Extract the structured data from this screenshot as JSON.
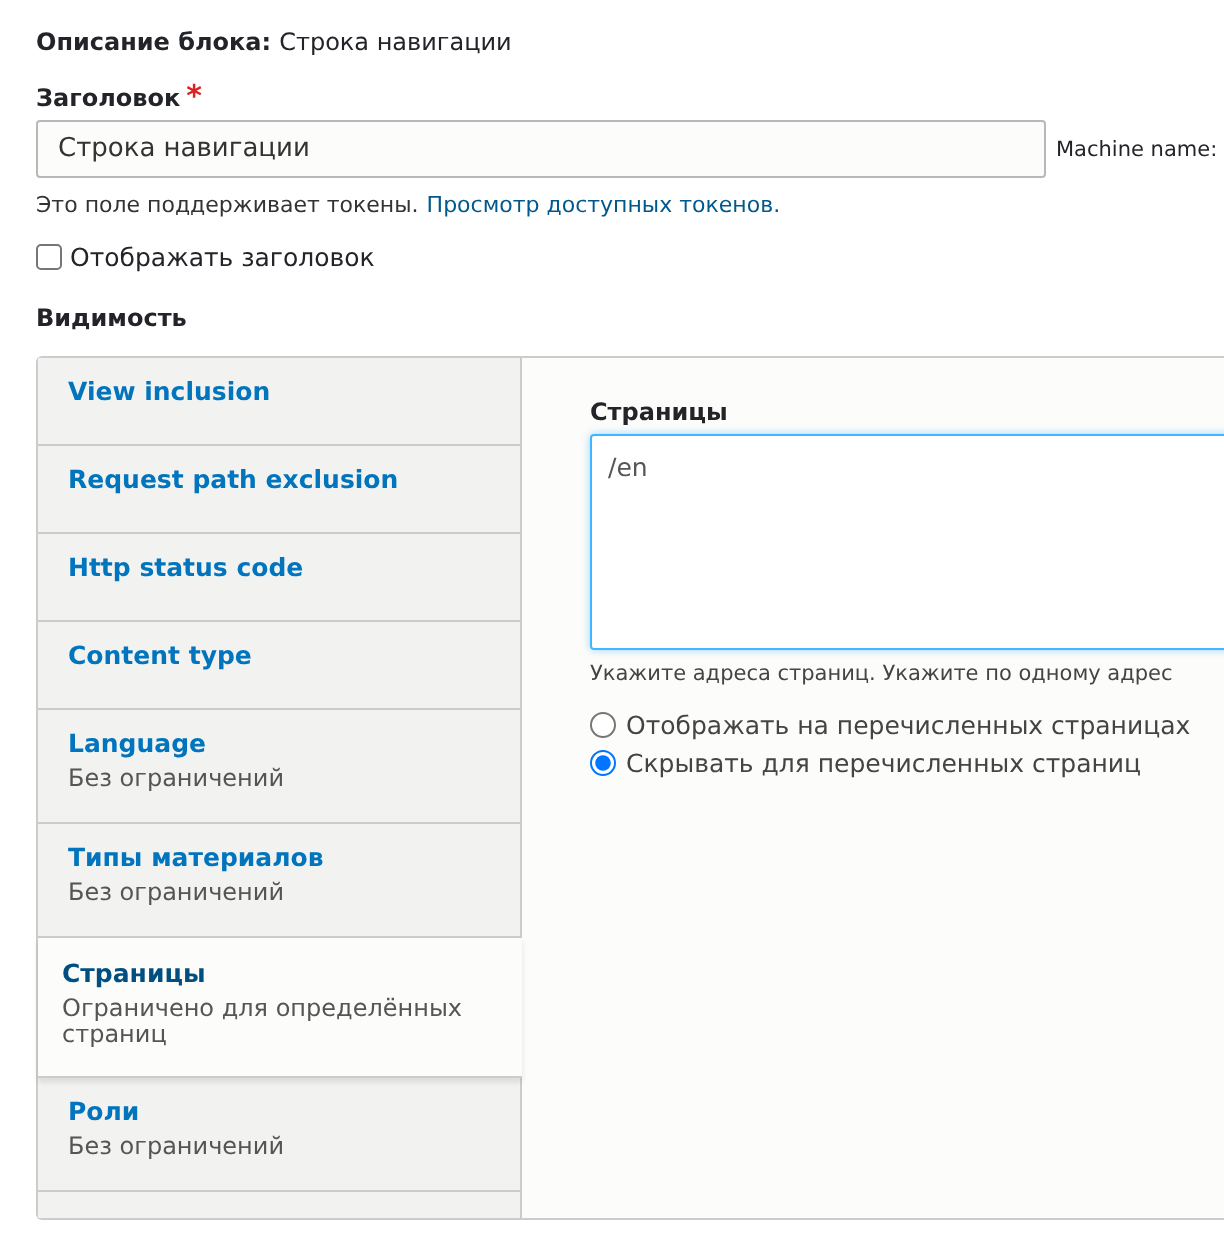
{
  "block_description": {
    "label": "Описание блока:",
    "value": "Строка навигации"
  },
  "title_field": {
    "label": "Заголовок",
    "required_mark": "*",
    "value": "Строка навигации",
    "machine_name_label": "Machine name:",
    "help": "Это поле поддерживает токены.",
    "help_link": "Просмотр доступных токенов."
  },
  "display_title": {
    "label": "Отображать заголовок",
    "checked": false
  },
  "visibility": {
    "heading": "Видимость",
    "tabs": [
      {
        "title": "View inclusion",
        "selected": false
      },
      {
        "title": "Request path exclusion",
        "selected": false
      },
      {
        "title": "Http status code",
        "selected": false
      },
      {
        "title": "Content type",
        "selected": false
      },
      {
        "title": "Language",
        "summary": "Без ограничений",
        "selected": false
      },
      {
        "title": "Типы материалов",
        "summary": "Без ограничений",
        "selected": false
      },
      {
        "title": "Страницы",
        "summary": "Ограничено для определённых страниц",
        "selected": true
      },
      {
        "title": "Роли",
        "summary": "Без ограничений",
        "selected": false
      }
    ],
    "pane": {
      "label": "Страницы",
      "value": "/en",
      "help": "Укажите адреса страниц. Укажите по одному адрес",
      "options": [
        {
          "label": "Отображать на перечисленных страницах",
          "selected": false
        },
        {
          "label": "Скрывать для перечисленных страниц",
          "selected": true
        }
      ]
    }
  }
}
